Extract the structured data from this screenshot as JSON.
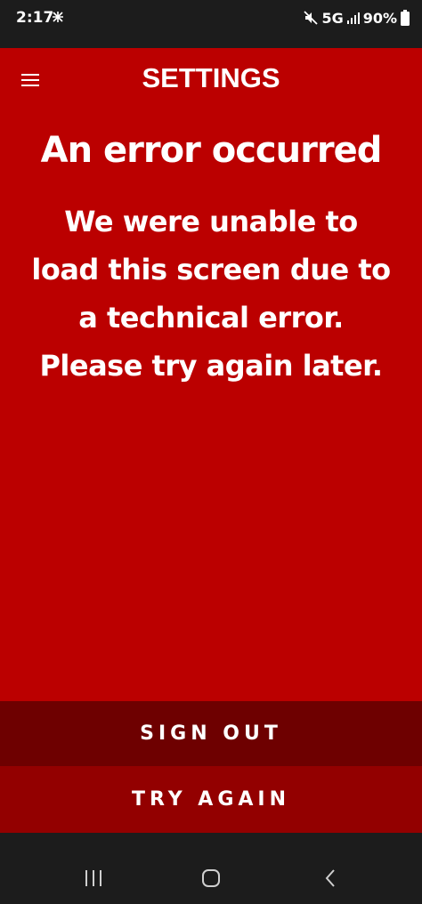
{
  "status_bar": {
    "time": "2:17",
    "network": "5G",
    "battery": "90%"
  },
  "header": {
    "title": "SETTINGS",
    "menu_icon": "hamburger-menu-icon"
  },
  "error": {
    "title": "An error occurred",
    "message": "We were unable to load this screen due to a technical error. Please try again later."
  },
  "actions": {
    "sign_out_label": "SIGN OUT",
    "try_again_label": "TRY AGAIN"
  },
  "nav_bar": {
    "recents_icon": "recents-icon",
    "home_icon": "home-icon",
    "back_icon": "back-icon"
  },
  "colors": {
    "screen_background": "#bb0000",
    "sign_out_background": "#6e0000",
    "try_again_background": "#930000",
    "system_bar": "#1c1c1c",
    "text": "#ffffff"
  }
}
